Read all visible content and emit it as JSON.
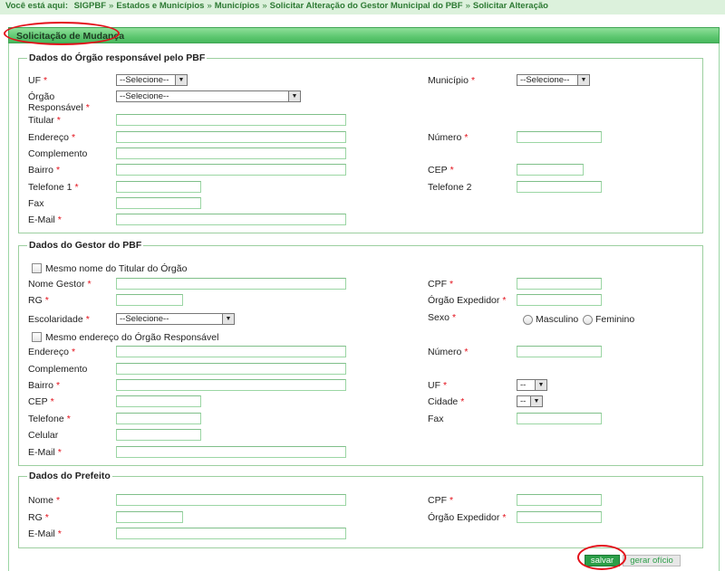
{
  "breadcrumb": {
    "lead": "Você está aqui:",
    "items": [
      "SIGPBF",
      "Estados e Municípios",
      "Municípios",
      "Solicitar Alteração do Gestor Municipal do PBF",
      "Solicitar Alteração"
    ],
    "separator": "»"
  },
  "section_title": "Solicitação de Mudança",
  "required_mark": "*",
  "select_placeholder": "--Selecione--",
  "select_short_placeholder": "--",
  "orgao": {
    "legend": "Dados do Órgão responsável pelo PBF",
    "uf": "UF",
    "municipio": "Município",
    "orgao_line1": "Órgão",
    "orgao_line2": "Responsável",
    "titular": "Titular",
    "endereco": "Endereço",
    "numero": "Número",
    "complemento": "Complemento",
    "bairro": "Bairro",
    "cep": "CEP",
    "telefone1": "Telefone 1",
    "telefone2": "Telefone 2",
    "fax": "Fax",
    "email": "E-Mail"
  },
  "gestor": {
    "legend": "Dados do Gestor do PBF",
    "mesmo_nome": "Mesmo nome do Titular do Órgão",
    "nome_gestor": "Nome Gestor",
    "cpf": "CPF",
    "rg": "RG",
    "orgao_expedidor": "Órgão Expedidor",
    "escolaridade": "Escolaridade",
    "sexo": "Sexo",
    "masculino": "Masculino",
    "feminino": "Feminino",
    "mesmo_endereco": "Mesmo endereço do Órgão Responsável",
    "endereco": "Endereço",
    "numero": "Número",
    "complemento": "Complemento",
    "bairro": "Bairro",
    "uf": "UF",
    "cep": "CEP",
    "cidade": "Cidade",
    "telefone": "Telefone",
    "fax": "Fax",
    "celular": "Celular",
    "email": "E-Mail"
  },
  "prefeito": {
    "legend": "Dados do Prefeito",
    "nome": "Nome",
    "cpf": "CPF",
    "rg": "RG",
    "orgao_expedidor": "Órgão Expedidor",
    "email": "E-Mail"
  },
  "actions": {
    "salvar": "salvar",
    "gerar_oficio": "gerar ofício"
  },
  "colors": {
    "accent_green": "#2c9e48",
    "header_green": "#5dc770",
    "annotation_red": "#e3101a"
  }
}
